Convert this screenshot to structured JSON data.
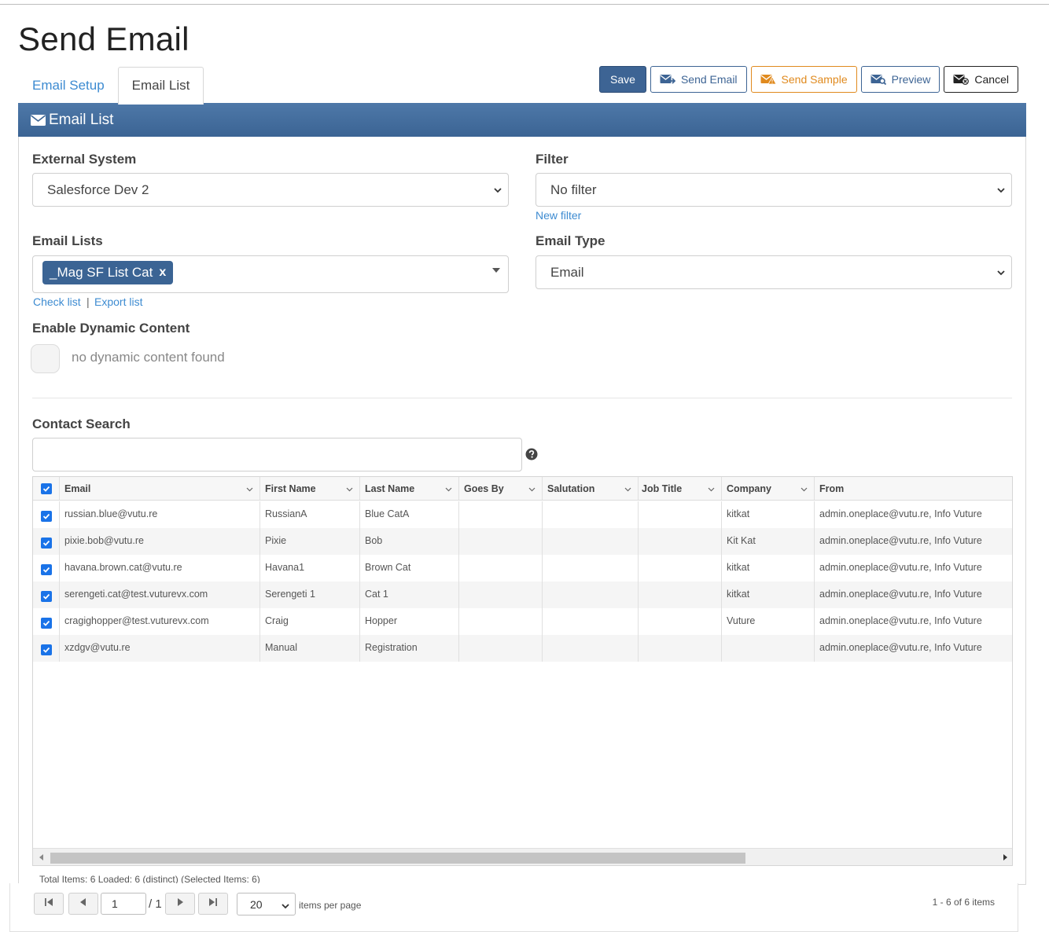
{
  "page": {
    "title": "Send Email"
  },
  "tabs": [
    {
      "label": "Email Setup",
      "active": false
    },
    {
      "label": "Email List",
      "active": true
    }
  ],
  "toolbar": {
    "save": "Save",
    "send_email": "Send Email",
    "send_sample": "Send Sample",
    "preview": "Preview",
    "cancel": "Cancel"
  },
  "panel": {
    "title": "Email List"
  },
  "form": {
    "external_system": {
      "label": "External System",
      "value": "Salesforce Dev 2"
    },
    "filter": {
      "label": "Filter",
      "value": "No filter",
      "new_filter_link": "New filter"
    },
    "email_lists": {
      "label": "Email Lists",
      "selected": [
        "_Mag SF List Cat"
      ],
      "remove_symbol": "x",
      "check_list_link": "Check list",
      "separator": "|",
      "export_list_link": "Export list"
    },
    "email_type": {
      "label": "Email Type",
      "value": "Email"
    },
    "dynamic_content": {
      "label": "Enable Dynamic Content",
      "message": "no dynamic content found",
      "enabled": false
    },
    "contact_search": {
      "label": "Contact Search",
      "value": "",
      "placeholder": ""
    }
  },
  "grid": {
    "columns": [
      "Email",
      "First Name",
      "Last Name",
      "Goes By",
      "Salutation",
      "Job Title",
      "Company",
      "From"
    ],
    "rows": [
      {
        "checked": true,
        "cells": [
          "russian.blue@vutu.re",
          "RussianA",
          "Blue CatA",
          "",
          "",
          "",
          "kitkat",
          "admin.oneplace@vutu.re, Info Vuture"
        ]
      },
      {
        "checked": true,
        "cells": [
          "pixie.bob@vutu.re",
          "Pixie",
          "Bob",
          "",
          "",
          "",
          "Kit Kat",
          "admin.oneplace@vutu.re, Info Vuture"
        ]
      },
      {
        "checked": true,
        "cells": [
          "havana.brown.cat@vutu.re",
          "Havana1",
          "Brown Cat",
          "",
          "",
          "",
          "kitkat",
          "admin.oneplace@vutu.re, Info Vuture"
        ]
      },
      {
        "checked": true,
        "cells": [
          "serengeti.cat@test.vuturevx.com",
          "Serengeti 1",
          "Cat 1",
          "",
          "",
          "",
          "kitkat",
          "admin.oneplace@vutu.re, Info Vuture"
        ]
      },
      {
        "checked": true,
        "cells": [
          "cragighopper@test.vuturevx.com",
          "Craig",
          "Hopper",
          "",
          "",
          "",
          "Vuture",
          "admin.oneplace@vutu.re, Info Vuture"
        ]
      },
      {
        "checked": true,
        "cells": [
          "xzdgv@vutu.re",
          "Manual",
          "Registration",
          "",
          "",
          "",
          "",
          "admin.oneplace@vutu.re, Info Vuture"
        ]
      }
    ],
    "status": "Total Items: 6 Loaded: 6 (distinct) (Selected Items: 6)"
  },
  "pager": {
    "page": "1",
    "of_pages": "/ 1",
    "page_size": "20",
    "per_page_label": "items per page",
    "info": "1 - 6 of 6 items"
  },
  "colors": {
    "primary": "#3b6494",
    "link": "#3d8bd1",
    "sample": "#e08a1e",
    "checkbox": "#1a73e8"
  }
}
